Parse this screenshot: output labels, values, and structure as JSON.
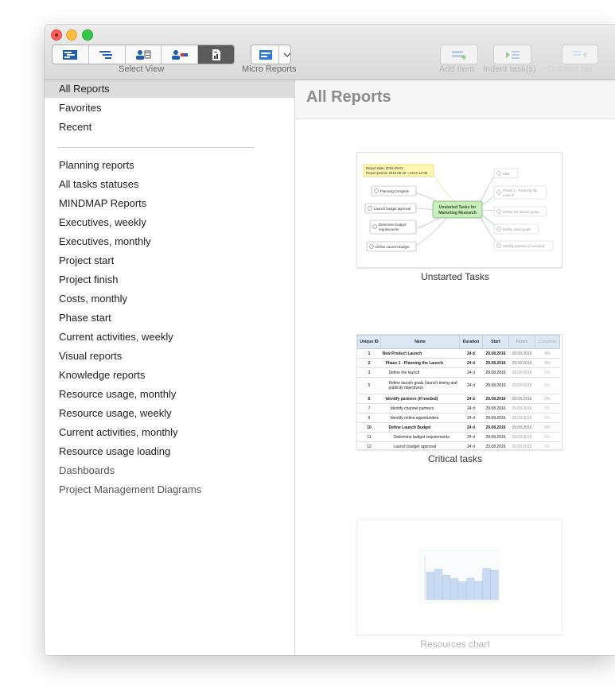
{
  "toolbar": {
    "select_view_label": "Select View",
    "micro_reports_label": "Micro Reports",
    "add_item_label": "Add Item",
    "indent_label": "Indent task(s)",
    "outdent_label": "Outdent tas"
  },
  "sidebar": {
    "top_items": [
      "All Reports",
      "Favorites",
      "Recent"
    ],
    "report_items": [
      "Planning reports",
      "All tasks statuses",
      "MINDMAP Reports",
      "Executives, weekly",
      "Executives, monthly",
      "Project start",
      "Project finish",
      "Costs, monthly",
      "Phase start",
      "Current activities, weekly",
      "Visual reports",
      "Knowledge reports",
      "Resource usage, monthly",
      "Resource usage, weekly",
      "Current activities, monthly",
      "Resource usage loading"
    ],
    "group_items": [
      "Dashboards",
      "Project Management Diagrams"
    ]
  },
  "main": {
    "title": "All Reports",
    "reports": [
      {
        "name": "Unstarted Tasks"
      },
      {
        "name": "Critical tasks"
      },
      {
        "name": "Resources chart"
      }
    ],
    "mindmap": {
      "report_date": "Report date:  2016-09-01",
      "report_period": "Report period:  2016-08-22 – 2017-12-09",
      "center": "Unstarted Tasks for Marketing Research",
      "left_nodes": [
        "Planning Complete",
        "Launch budget approval",
        "Determine budget requirements",
        "Define Launch Budget"
      ],
      "right_nodes": [
        "Idea",
        "Phase 1 - Planning the Launch",
        "Define the launch group",
        "Define sales goals",
        "Identify partners (if needed)"
      ]
    },
    "critical_table": {
      "headers": [
        "Unique ID",
        "Name",
        "Duration",
        "Start",
        "Finish",
        "Complete"
      ],
      "rows": [
        [
          "1",
          "New Product Launch",
          "24 d",
          "29.08.2016",
          "29.09.2016",
          "0%"
        ],
        [
          "2",
          "Phase 1 - Planning the Launch",
          "24 d",
          "29.08.2016",
          "29.09.2016",
          "0%"
        ],
        [
          "3",
          "Define the launch",
          "24 d",
          "29.08.2016",
          "29.09.2016",
          "0%"
        ],
        [
          "5",
          "Define launch goals (launch timing and publicity objectives)",
          "24 d",
          "29.08.2016",
          "29.09.2016",
          "0%"
        ],
        [
          "6",
          "Identify partners (if needed)",
          "24 d",
          "29.08.2016",
          "29.09.2016",
          "0%"
        ],
        [
          "7",
          "Identify channel partners",
          "24 d",
          "29.08.2016",
          "29.09.2016",
          "0%"
        ],
        [
          "9",
          "Identify online opportunities",
          "24 d",
          "29.08.2016",
          "29.09.2016",
          "0%"
        ],
        [
          "10",
          "Define Launch Budget",
          "24 d",
          "29.08.2016",
          "29.09.2016",
          "0%"
        ],
        [
          "11",
          "Determine budget requirements",
          "24 d",
          "29.08.2016",
          "29.09.2016",
          "0%"
        ],
        [
          "12",
          "Launch budget approval",
          "24 d",
          "29.08.2016",
          "29.09.2016",
          "0%"
        ]
      ]
    },
    "resource_bars": [
      0.62,
      0.68,
      0.55,
      0.47,
      0.4,
      0.48,
      0.41,
      0.7,
      0.66
    ]
  },
  "colors": {
    "accent_blue": "#2a79d4",
    "selected_row": "#dcdcdc"
  }
}
